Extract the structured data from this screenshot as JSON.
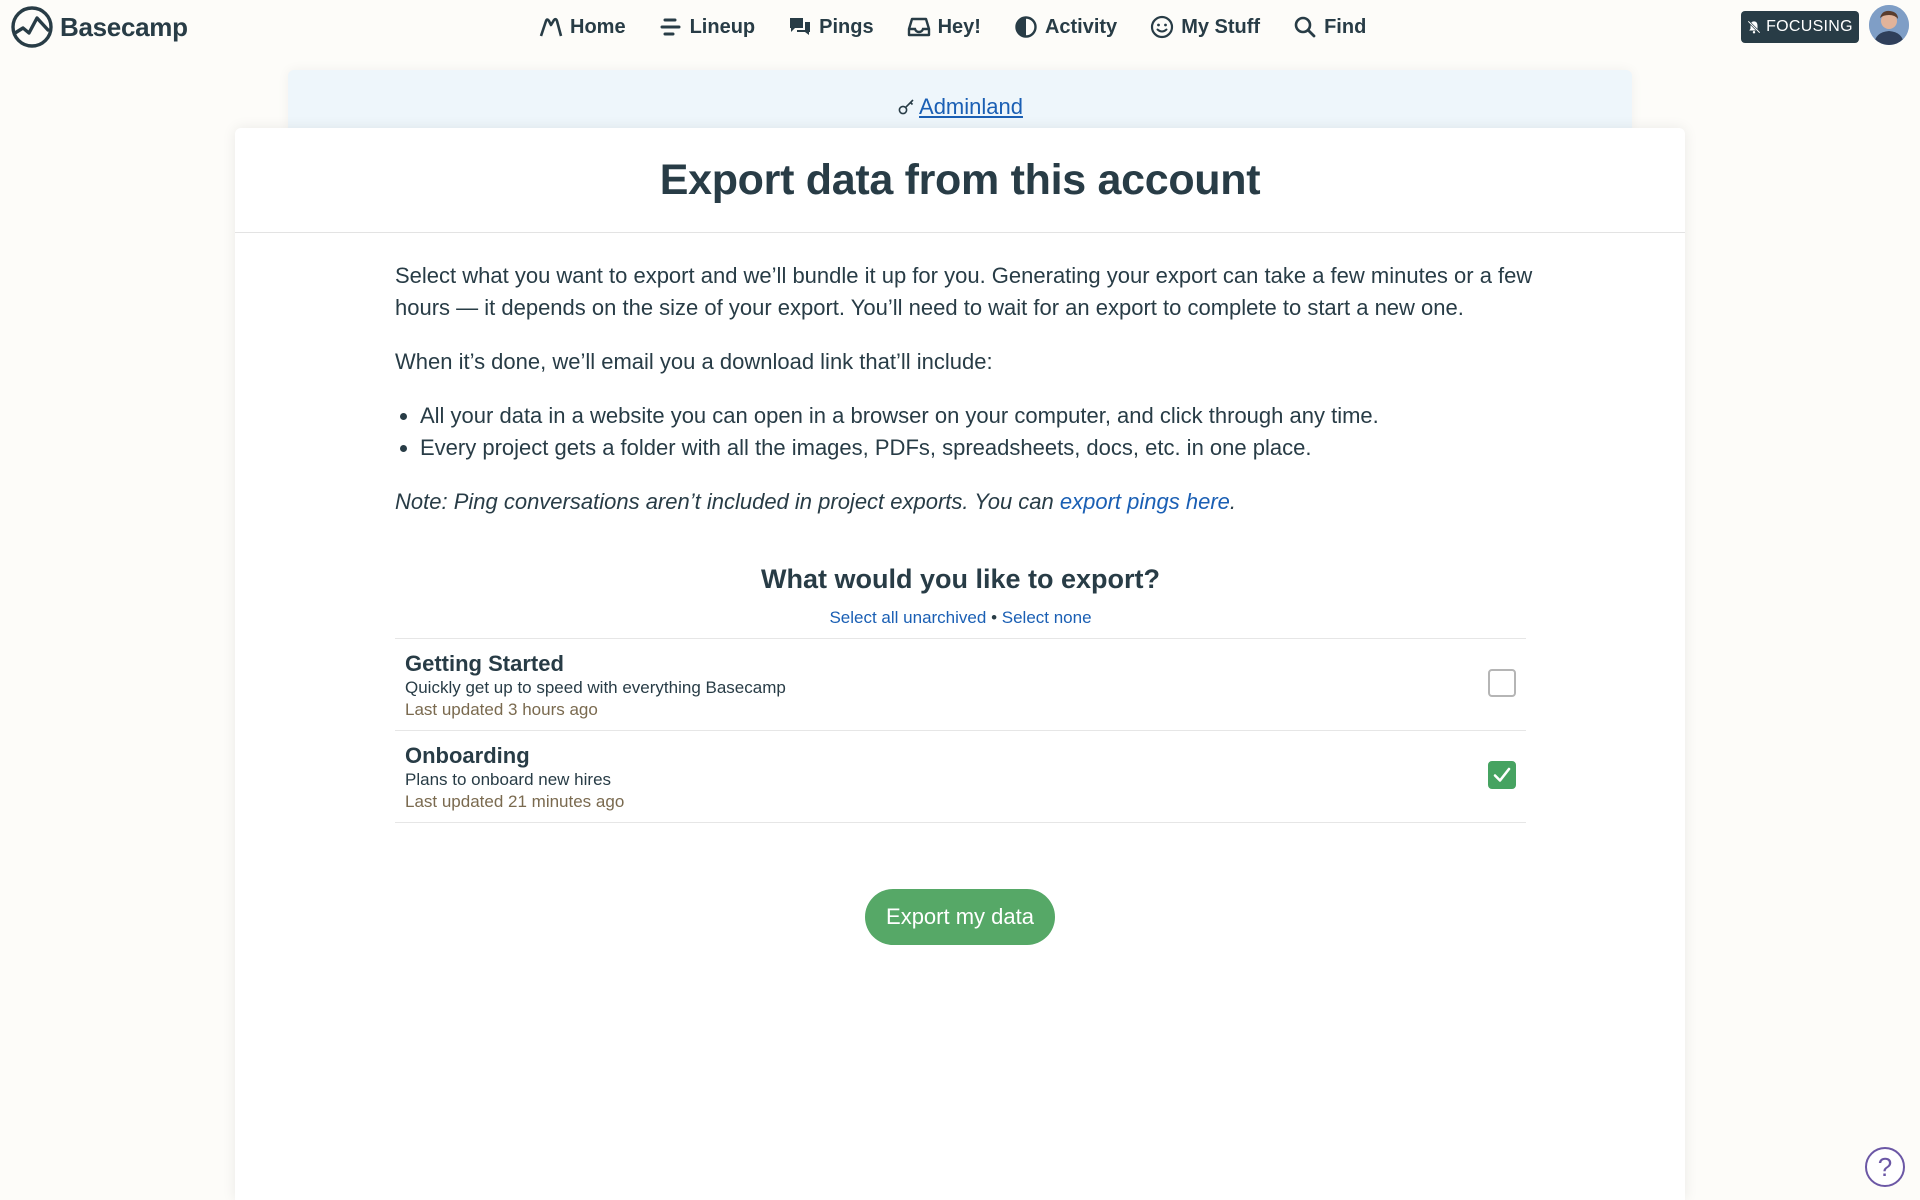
{
  "app": {
    "name": "Basecamp"
  },
  "nav": {
    "items": [
      {
        "label": "Home",
        "icon": "home-icon"
      },
      {
        "label": "Lineup",
        "icon": "lineup-icon"
      },
      {
        "label": "Pings",
        "icon": "pings-icon"
      },
      {
        "label": "Hey!",
        "icon": "hey-icon"
      },
      {
        "label": "Activity",
        "icon": "activity-icon"
      },
      {
        "label": "My Stuff",
        "icon": "my-stuff-icon"
      },
      {
        "label": "Find",
        "icon": "find-icon"
      }
    ],
    "focusing_label": "FOCUSING"
  },
  "breadcrumb": {
    "label": "Adminland"
  },
  "page": {
    "title": "Export data from this account",
    "intro": "Select what you want to export and we’ll bundle it up for you. Generating your export can take a few minutes or a few hours — it depends on the size of your export. You’ll need to wait for an export to complete to start a new one.",
    "when_done": "When it’s done, we’ll email you a download link that’ll include:",
    "bullets": [
      "All your data in a website you can open in a browser on your computer, and click through any time.",
      "Every project gets a folder with all the images, PDFs, spreadsheets, docs, etc. in one place."
    ],
    "note_prefix": "Note: Ping conversations aren’t included in project exports. You can ",
    "note_link": "export pings here",
    "note_suffix": "."
  },
  "export": {
    "heading": "What would you like to export?",
    "select_all": "Select all unarchived",
    "separator": "•",
    "select_none": "Select none",
    "projects": [
      {
        "name": "Getting Started",
        "description": "Quickly get up to speed with everything Basecamp",
        "updated": "Last updated 3 hours ago",
        "checked": false
      },
      {
        "name": "Onboarding",
        "description": "Plans to onboard new hires",
        "updated": "Last updated 21 minutes ago",
        "checked": true
      }
    ],
    "button_label": "Export my data"
  },
  "help": {
    "label": "?"
  },
  "colors": {
    "accent_green": "#56a867",
    "text_dark": "#283c46",
    "link_blue": "#1a5fb4",
    "help_purple": "#6b57a5"
  }
}
